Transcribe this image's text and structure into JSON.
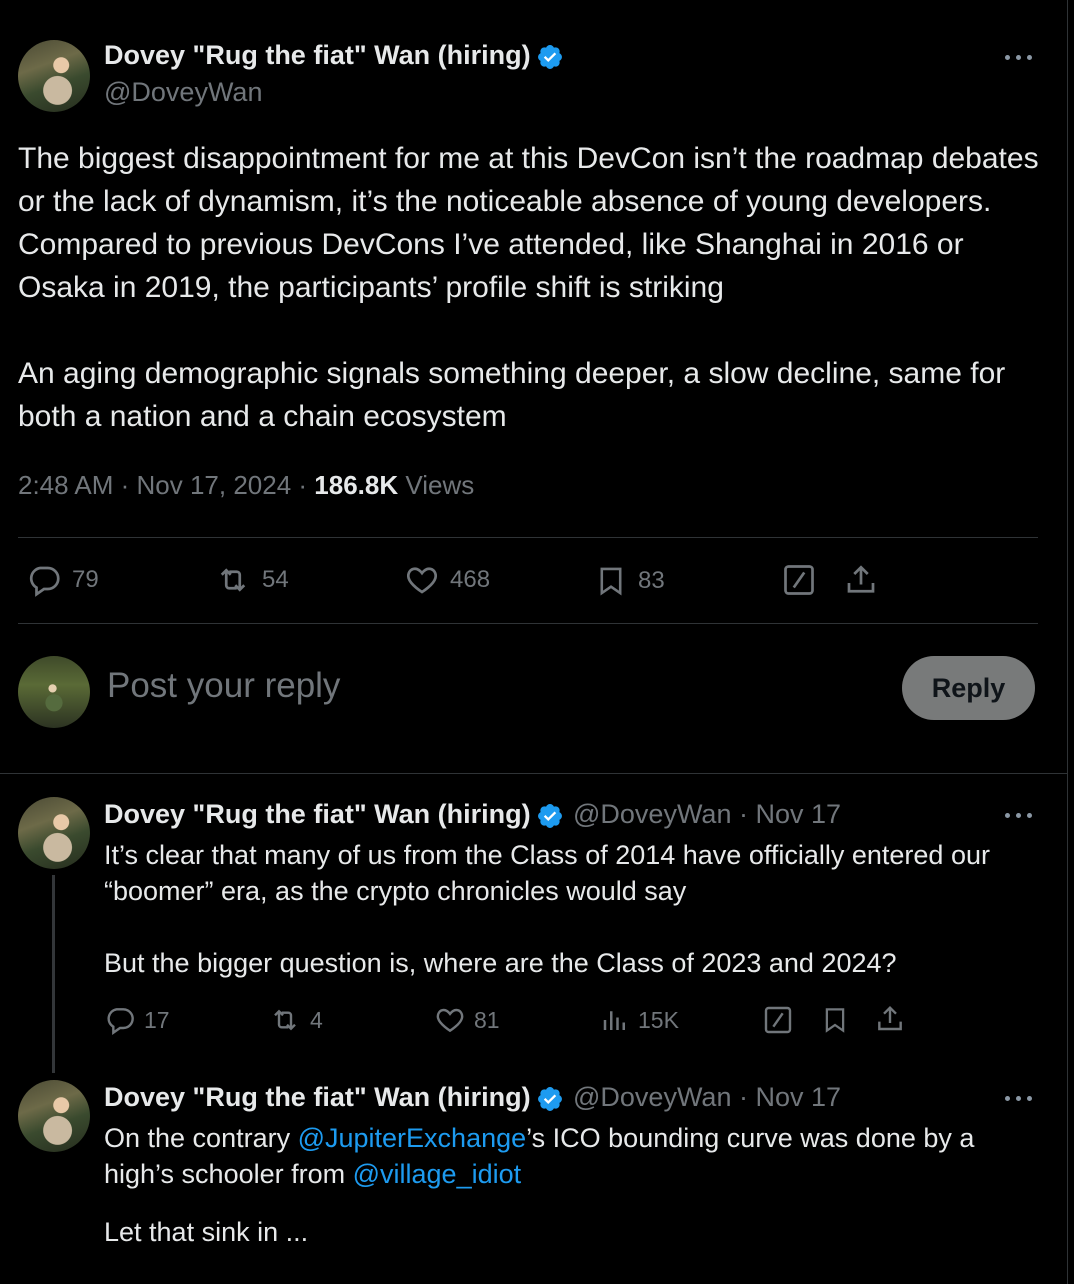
{
  "main_tweet": {
    "author_name": "Dovey \"Rug the fiat\" Wan (hiring)",
    "handle": "@DoveyWan",
    "paragraph_1": "The biggest disappointment for me at this DevCon isn’t the roadmap debates or the lack of dynamism, it’s the noticeable absence of young developers. Compared to previous DevCons I’ve attended, like Shanghai in 2016 or Osaka in 2019, the participants’ profile shift is striking",
    "paragraph_2": "An aging demographic signals something deeper, a slow decline, same for both a nation and a chain ecosystem",
    "time": "2:48 AM",
    "date": "Nov 17, 2024",
    "views_count": "186.8K",
    "views_label": "Views",
    "replies": "79",
    "reposts": "54",
    "likes": "468",
    "bookmarks": "83"
  },
  "composer": {
    "placeholder": "Post your reply",
    "reply_button": "Reply"
  },
  "replies": [
    {
      "author_name": "Dovey \"Rug the fiat\" Wan (hiring)",
      "handle_date": "@DoveyWan · Nov 17",
      "paragraph_1": "It’s clear that many of us from the Class of 2014 have officially entered our “boomer” era, as the crypto chronicles would say",
      "paragraph_2": "But the bigger question is, where are the Class of 2023 and 2024?",
      "replies": "17",
      "reposts": "4",
      "likes": "81",
      "views": "15K"
    },
    {
      "author_name": "Dovey \"Rug the fiat\" Wan (hiring)",
      "handle_date": "@DoveyWan · Nov 17",
      "text_a": "On the contrary ",
      "mention_1": "@JupiterExchange",
      "text_b": "’s ICO bounding curve was done by a high’s schooler from ",
      "mention_2": "@village_idiot",
      "paragraph_2": "Let that sink in ..."
    }
  ],
  "colors": {
    "background": "#000000",
    "text": "#e7e9ea",
    "muted": "#71767b",
    "accent": "#1d9bf0",
    "divider": "#2f3336"
  },
  "icons": [
    "verified-badge-icon",
    "more-icon",
    "reply-icon",
    "repost-icon",
    "like-icon",
    "bookmark-icon",
    "grok-icon",
    "share-icon",
    "views-icon"
  ]
}
